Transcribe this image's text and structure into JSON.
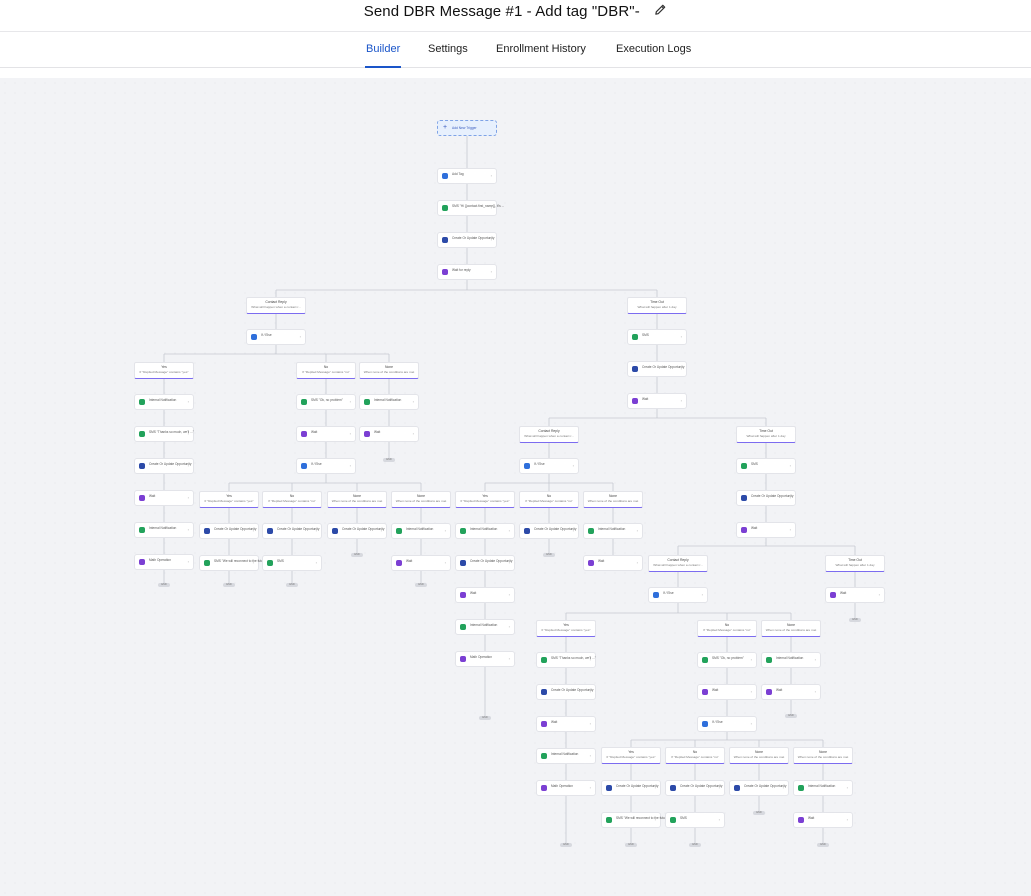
{
  "header": {
    "title": "Send DBR Message #1 - Add tag \"DBR\"-",
    "edit_icon": "pencil-icon"
  },
  "tabs": [
    {
      "label": "Builder",
      "active": true
    },
    {
      "label": "Settings",
      "active": false
    },
    {
      "label": "Enrollment History",
      "active": false
    },
    {
      "label": "Execution Logs",
      "active": false
    }
  ],
  "canvas": {
    "trigger": "Add New Trigger",
    "end_label": "END",
    "nodes": [
      {
        "label": "Add Tag",
        "icon": "blue"
      },
      {
        "label": "SMS \"Hi {{contact.first_name}}, it's ...",
        "icon": "green"
      },
      {
        "label": "Create Or Update Opportunity",
        "icon": "navy"
      },
      {
        "label": "Wait for reply",
        "icon": "purple"
      },
      {
        "label": "If / Else",
        "icon": "blue"
      },
      {
        "label": "SMS",
        "icon": "green"
      },
      {
        "label": "Create Or Update Opportunity",
        "icon": "navy"
      },
      {
        "label": "Wait",
        "icon": "purple"
      },
      {
        "label": "Internal Notification",
        "icon": "green"
      },
      {
        "label": "SMS \"Thanks so much, we'll ...\"",
        "icon": "green"
      },
      {
        "label": "Create Or Update Opportunity",
        "icon": "navy"
      },
      {
        "label": "Wait",
        "icon": "purple"
      },
      {
        "label": "Internal Notification",
        "icon": "green"
      },
      {
        "label": "Math Operation",
        "icon": "purple"
      },
      {
        "label": "SMS \"Ok, no problem\"",
        "icon": "green"
      },
      {
        "label": "Wait",
        "icon": "purple"
      },
      {
        "label": "If / Else",
        "icon": "blue"
      },
      {
        "label": "Internal Notification",
        "icon": "green"
      },
      {
        "label": "Wait",
        "icon": "purple"
      },
      {
        "label": "Create Or Update Opportunity",
        "icon": "navy"
      },
      {
        "label": "SMS \"We will reconnect to the future\"",
        "icon": "green"
      },
      {
        "label": "Create Or Update Opportunity",
        "icon": "navy"
      },
      {
        "label": "SMS",
        "icon": "green"
      },
      {
        "label": "Create Or Update Opportunity",
        "icon": "navy"
      },
      {
        "label": "Internal Notification",
        "icon": "green"
      },
      {
        "label": "Wait",
        "icon": "purple"
      },
      {
        "label": "Internal Notification",
        "icon": "green"
      },
      {
        "label": "Create Or Update Opportunity",
        "icon": "navy"
      },
      {
        "label": "Wait",
        "icon": "purple"
      },
      {
        "label": "Internal Notification",
        "icon": "green"
      },
      {
        "label": "Math Operation",
        "icon": "purple"
      },
      {
        "label": "Internal Notification",
        "icon": "green"
      },
      {
        "label": "SMS \"Thanks so much, we'll ...\"",
        "icon": "green"
      },
      {
        "label": "Create Or Update Opportunity",
        "icon": "navy"
      },
      {
        "label": "Wait",
        "icon": "purple"
      },
      {
        "label": "Internal Notification",
        "icon": "green"
      },
      {
        "label": "Math Operation",
        "icon": "purple"
      }
    ],
    "branches": [
      {
        "title": "Contact Reply",
        "subtitle": "What will happen when a contact r..."
      },
      {
        "title": "Time Out",
        "subtitle": "What will happen after 1 day"
      },
      {
        "title": "Yes",
        "subtitle": "If \"Replied Message\" contains \"yes\""
      },
      {
        "title": "No",
        "subtitle": "If \"Replied Message\" contains \"no\""
      },
      {
        "title": "None",
        "subtitle": "When none of the conditions are met"
      }
    ]
  }
}
